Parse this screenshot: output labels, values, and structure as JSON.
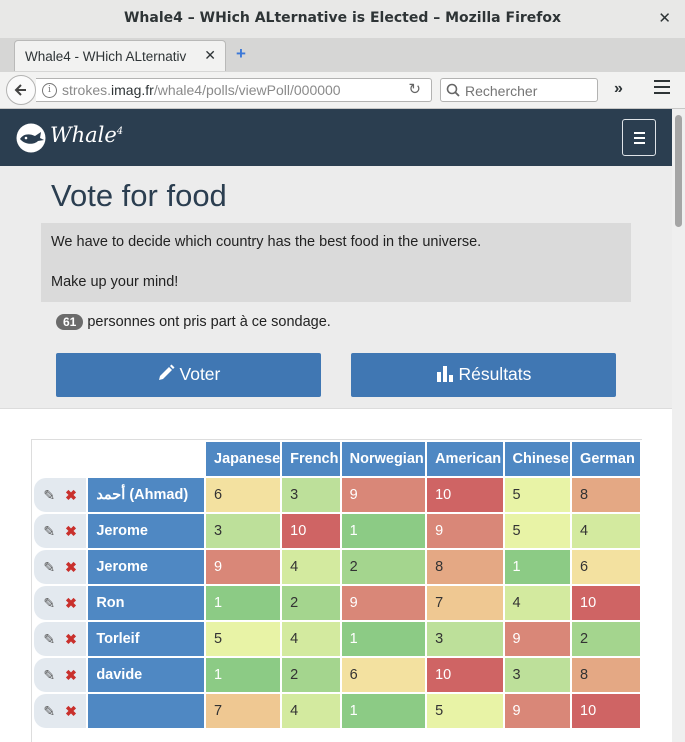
{
  "window": {
    "title": "Whale4 – WHich ALternative is Elected – Mozilla Firefox",
    "close": "✕"
  },
  "tabs": [
    {
      "label": "Whale4 - WHich ALternativ",
      "close": "✕"
    }
  ],
  "newtab": "+",
  "nav": {
    "url_prefix": "strokes.",
    "url_host": "imag.fr",
    "url_path": "/whale4/polls/viewPoll/000000",
    "search_placeholder": "Rechercher",
    "chevrons": "»"
  },
  "app": {
    "logo_text": "Whale",
    "logo_sup": "4"
  },
  "poll": {
    "title": "Vote for food",
    "desc_line1": "We have to decide which country has the best food in the universe.",
    "desc_line2": "Make up your mind!",
    "participants": "61",
    "participants_text": "personnes ont pris part à ce sondage.",
    "vote_label": "Voter",
    "results_label": "Résultats"
  },
  "table": {
    "columns": [
      "Japanese",
      "French",
      "Norwegian",
      "American",
      "Chinese",
      "German"
    ],
    "rows": [
      {
        "name": "أحمد (Ahmad)",
        "values": [
          "6",
          "3",
          "9",
          "10",
          "5",
          "8"
        ]
      },
      {
        "name": "Jerome",
        "values": [
          "3",
          "10",
          "1",
          "9",
          "5",
          "4"
        ]
      },
      {
        "name": "Jerome",
        "values": [
          "9",
          "4",
          "2",
          "8",
          "1",
          "6"
        ]
      },
      {
        "name": "Ron",
        "values": [
          "1",
          "2",
          "9",
          "7",
          "4",
          "10"
        ]
      },
      {
        "name": "Torleif",
        "values": [
          "5",
          "4",
          "1",
          "3",
          "9",
          "2"
        ]
      },
      {
        "name": "davide",
        "values": [
          "1",
          "2",
          "6",
          "10",
          "3",
          "8"
        ]
      },
      {
        "name": "",
        "values": [
          "7",
          "4",
          "1",
          "5",
          "9",
          "10"
        ]
      }
    ]
  },
  "colors": {
    "scale": {
      "1": "#8ccb85",
      "2": "#a4d58e",
      "3": "#bde09a",
      "4": "#d3ea9f",
      "5": "#e8f3a6",
      "6": "#f3e1a0",
      "7": "#efc892",
      "8": "#e4a884",
      "9": "#d98778",
      "10": "#cf6464"
    },
    "navbar": "#2b3e50",
    "primary": "#4077b3"
  },
  "icons": {
    "pencil": "✎",
    "delete": "✖",
    "bar_chart": "bar-chart-icon"
  }
}
